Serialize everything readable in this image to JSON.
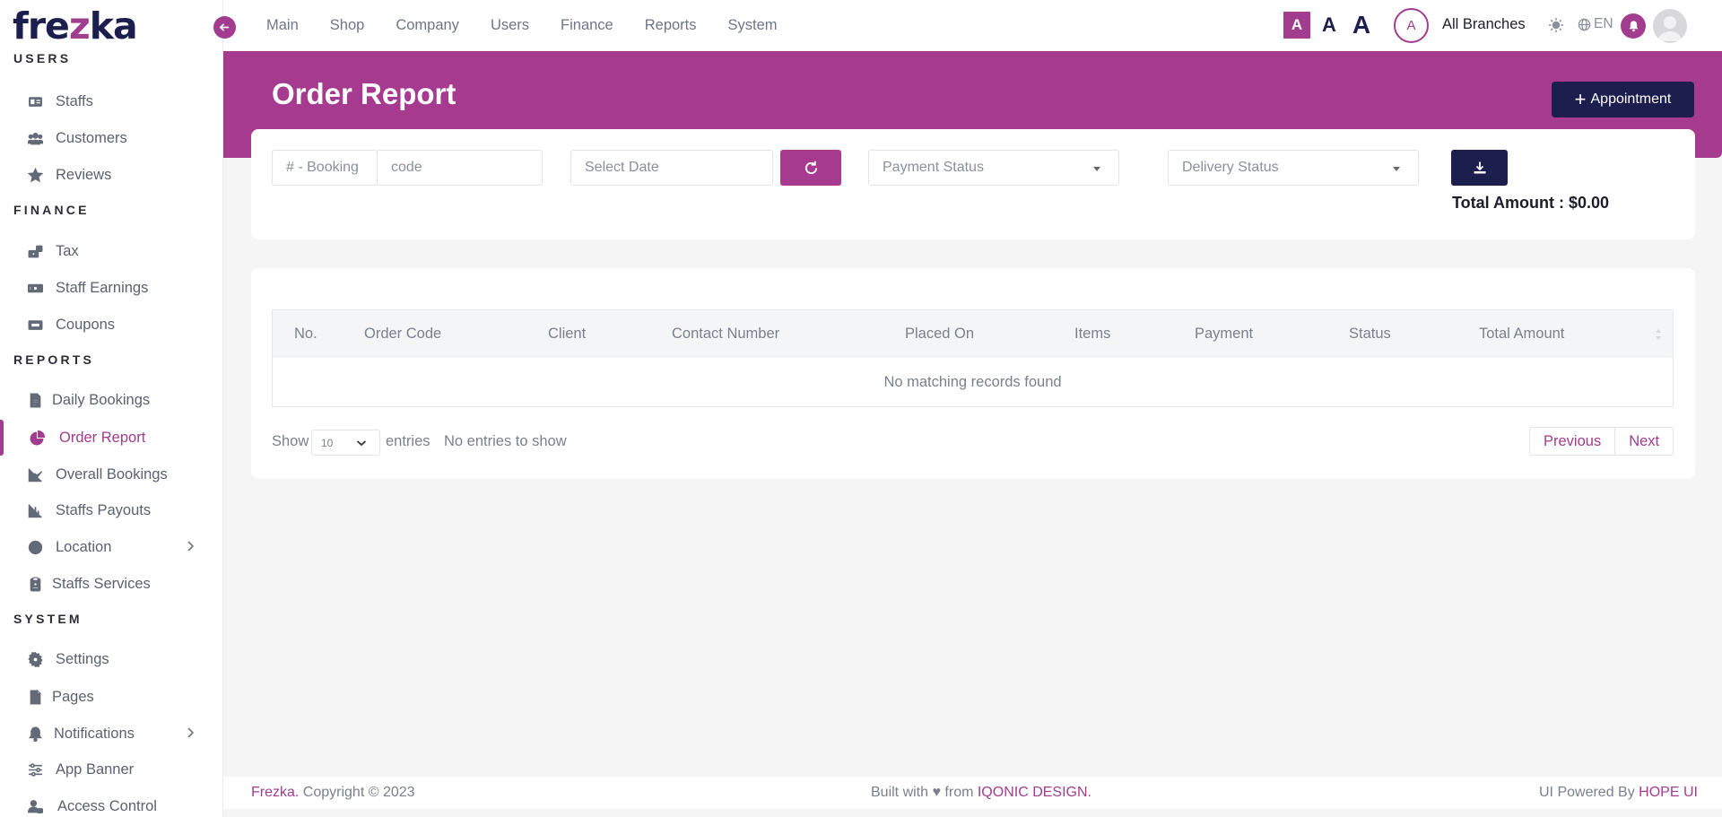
{
  "brand": {
    "name_prefix": "fre",
    "name_z": "z",
    "name_suffix": "ka"
  },
  "topnav": {
    "items": [
      "Main",
      "Shop",
      "Company",
      "Users",
      "Finance",
      "Reports",
      "System"
    ],
    "font_sizes": [
      "A",
      "A",
      "A"
    ],
    "branch_initial": "A",
    "branch_name": "All Branches",
    "language": "EN"
  },
  "sidebar": {
    "sections": {
      "users": "USERS",
      "finance": "FINANCE",
      "reports": "REPORTS",
      "system": "SYSTEM"
    },
    "items": [
      {
        "label": "Staffs",
        "icon": "id-card-icon"
      },
      {
        "label": "Customers",
        "icon": "users-icon"
      },
      {
        "label": "Reviews",
        "icon": "star-icon"
      },
      {
        "label": "Tax",
        "icon": "tax-icon"
      },
      {
        "label": "Staff Earnings",
        "icon": "money-icon"
      },
      {
        "label": "Coupons",
        "icon": "ticket-icon"
      },
      {
        "label": "Daily Bookings",
        "icon": "file-icon"
      },
      {
        "label": "Order Report",
        "icon": "pie-chart-icon",
        "active": true
      },
      {
        "label": "Overall Bookings",
        "icon": "line-chart-icon"
      },
      {
        "label": "Staffs Payouts",
        "icon": "bar-chart-icon"
      },
      {
        "label": "Location",
        "icon": "globe-icon"
      },
      {
        "label": "Staffs Services",
        "icon": "clipboard-icon"
      },
      {
        "label": "Settings",
        "icon": "gear-icon"
      },
      {
        "label": "Pages",
        "icon": "page-icon"
      },
      {
        "label": "Notifications",
        "icon": "bell-icon"
      },
      {
        "label": "App Banner",
        "icon": "sliders-icon"
      },
      {
        "label": "Access Control",
        "icon": "user-lock-icon"
      }
    ]
  },
  "page": {
    "title": "Order Report",
    "appointment_button": "Appointment"
  },
  "filters": {
    "booking_prefix": "# - Booking",
    "code_placeholder": "code",
    "date_placeholder": "Select Date",
    "payment_status": "Payment Status",
    "delivery_status": "Delivery Status",
    "total_label": "Total Amount : ",
    "total_value": "$0.00"
  },
  "table": {
    "columns": [
      "No.",
      "Order Code",
      "Client",
      "Contact Number",
      "Placed On",
      "Items",
      "Payment",
      "Status",
      "Total Amount"
    ],
    "empty_message": "No matching records found",
    "show_label": "Show",
    "page_size": "10",
    "entries_label": "entries",
    "info": "No entries to show",
    "prev": "Previous",
    "next": "Next"
  },
  "footer": {
    "brand": "Frezka.",
    "copyright": " Copyright © 2023",
    "built_with": "Built with ♥ from ",
    "built_by": "IQONIC DESIGN.",
    "powered_by": "UI Powered By ",
    "powered_name": "HOPE UI"
  },
  "colors": {
    "accent": "#a63a8e",
    "navy": "#1c1f4e"
  }
}
